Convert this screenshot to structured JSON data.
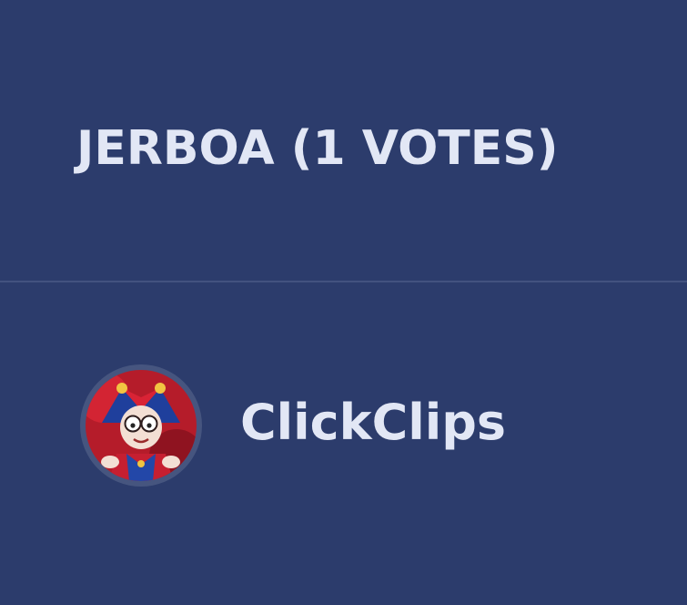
{
  "vote_option": {
    "title": "JERBOA (1 VOTES)"
  },
  "voters": [
    {
      "name": "ClickClips",
      "avatar_icon": "jester-character-avatar"
    }
  ],
  "colors": {
    "background": "#2c3c6c",
    "text": "#e2e7f5",
    "divider": "#43527f"
  }
}
